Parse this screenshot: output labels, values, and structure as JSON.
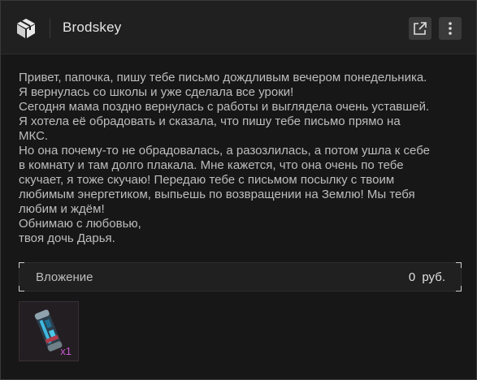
{
  "header": {
    "logo_icon": "cube-logo-icon",
    "title": "Brodskey",
    "buttons": [
      {
        "icon": "external-link-icon"
      },
      {
        "icon": "more-vertical-icon"
      }
    ]
  },
  "message": {
    "lines": [
      "Привет, папочка, пишу тебе письмо дождливым вечером понедельника.",
      "Я вернулась со школы и уже сделала все уроки!",
      "Сегодня мама поздно вернулась с работы и выглядела очень уставшей.",
      "Я хотела её обрадовать и сказала, что пишу тебе письмо прямо на",
      "МКС.",
      "Но она почему-то не обрадовалась, а разозлилась, а потом ушла к себе",
      "в комнату и там долго плакала. Мне кажется, что она очень по тебе",
      "скучает, я тоже скучаю! Передаю тебе с письмом посылку с твоим",
      "любимым энергетиком, выпьешь по возвращении на Землю! Мы тебя",
      "любим и ждём!",
      "Обнимаю с любовью,",
      "твоя дочь Дарья."
    ]
  },
  "attachment": {
    "label": "Вложение",
    "price": "0 руб."
  },
  "item": {
    "icon": "energy-drink-can-icon",
    "count": "x1",
    "count_color": "#c45bd1"
  }
}
